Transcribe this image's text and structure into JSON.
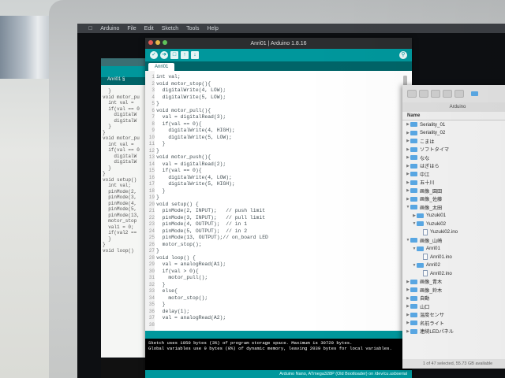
{
  "menubar": {
    "items": [
      "Arduino",
      "File",
      "Edit",
      "Sketch",
      "Tools",
      "Help"
    ]
  },
  "window": {
    "title": "Anri01 | Arduino 1.8.16",
    "tab": "Anri01"
  },
  "back_window": {
    "tab": "Anri01 §",
    "code": [
      "  }",
      "",
      "void motor_pu",
      "  int val =",
      "  if(val == 0",
      "    digitalW",
      "    digitalW",
      "  }",
      "}",
      "",
      "void motor_pu",
      "  int val =",
      "  if(val == 0",
      "    digitalW",
      "    digitalW",
      "  }",
      "}",
      "",
      "void setup()",
      "  int val;",
      "  pinMode(2,",
      "  pinMode(3,",
      "  pinMode(4,",
      "  pinMode(5,",
      "  pinMode(13,",
      "  motor_stop",
      "  val1 = 0;",
      "  if(val2 ==",
      "",
      "  }",
      "}",
      "",
      "void loop()"
    ]
  },
  "editor": {
    "line_numbers": [
      "1",
      "2",
      "3",
      "4",
      "5",
      "6",
      "7",
      "8",
      "9",
      "10",
      "11",
      "12",
      "13",
      "14",
      "15",
      "16",
      "17",
      "18",
      "19",
      "20",
      "21",
      "22",
      "23",
      "24",
      "25",
      "26",
      "27",
      "28",
      "29",
      "30",
      "31",
      "32",
      "33",
      "34",
      "35",
      "36",
      "37",
      "38"
    ],
    "lines": [
      "int val;",
      "",
      "void motor_stop(){",
      "  digitalWrite(4, LOW);",
      "  digitalWrite(5, LOW);",
      "}",
      "",
      "void motor_pull(){",
      "  val = digitalRead(3);",
      "  if(val == 0){",
      "    digitalWrite(4, HIGH);",
      "    digitalWrite(5, LOW);",
      "  }",
      "}",
      "",
      "void motor_push(){",
      "  val = digitalRead(2);",
      "  if(val == 0){",
      "    digitalWrite(4, LOW);",
      "    digitalWrite(5, HIGH);",
      "  }",
      "}",
      "",
      "void setup() {",
      "  pinMode(2, INPUT);   // push limit",
      "  pinMode(3, INPUT);   // pull limit",
      "  pinMode(4, OUTPUT);  // in 1",
      "  pinMode(5, OUTPUT);  // in 2",
      "  pinMode(13, OUTPUT);// on_board LED",
      "  motor_stop();",
      "}",
      "",
      "void loop() {",
      "  val = analogRead(A1);",
      "  if(val > 0){",
      "    motor_pull();",
      "  }",
      "  else{",
      "    motor_stop();",
      "  }",
      "  delay(1);",
      "  val = analogRead(A2);"
    ]
  },
  "console": {
    "lines": [
      "Sketch uses 1050 bytes (3%) of program storage space. Maximum is 30720 bytes.",
      "Global variables use 9 bytes (0%) of dynamic memory, leaving 2039 bytes for local variables."
    ],
    "board": "Arduino Nano, ATmega328P (Old Bootloader) on /dev/cu.usbserial"
  },
  "finder": {
    "title": "Arduino",
    "column_header": "Name",
    "rows": [
      {
        "indent": 0,
        "kind": "folder",
        "expanded": false,
        "name": "Seriality_01"
      },
      {
        "indent": 0,
        "kind": "folder",
        "expanded": false,
        "name": "Seriality_02"
      },
      {
        "indent": 0,
        "kind": "folder",
        "expanded": false,
        "name": "こまは"
      },
      {
        "indent": 0,
        "kind": "folder",
        "expanded": false,
        "name": "ソフトタイマ"
      },
      {
        "indent": 0,
        "kind": "folder",
        "expanded": false,
        "name": "なな"
      },
      {
        "indent": 0,
        "kind": "folder",
        "expanded": false,
        "name": "はぎはら"
      },
      {
        "indent": 0,
        "kind": "folder",
        "expanded": false,
        "name": "中江"
      },
      {
        "indent": 0,
        "kind": "folder",
        "expanded": false,
        "name": "五十川"
      },
      {
        "indent": 0,
        "kind": "folder",
        "expanded": false,
        "name": "画像_園田"
      },
      {
        "indent": 0,
        "kind": "folder",
        "expanded": false,
        "name": "画像_佐藤"
      },
      {
        "indent": 0,
        "kind": "folder",
        "expanded": true,
        "name": "画像_太田"
      },
      {
        "indent": 1,
        "kind": "folder",
        "expanded": false,
        "name": "Yuzuki01"
      },
      {
        "indent": 1,
        "kind": "folder",
        "expanded": true,
        "name": "Yuzuki02"
      },
      {
        "indent": 2,
        "kind": "file",
        "expanded": false,
        "name": "Yuzuki02.ino"
      },
      {
        "indent": 0,
        "kind": "folder",
        "expanded": true,
        "name": "画像_山崎"
      },
      {
        "indent": 1,
        "kind": "folder",
        "expanded": true,
        "name": "Anri01"
      },
      {
        "indent": 2,
        "kind": "file",
        "expanded": false,
        "name": "Anri01.ino"
      },
      {
        "indent": 1,
        "kind": "folder",
        "expanded": true,
        "name": "Anri02"
      },
      {
        "indent": 2,
        "kind": "file",
        "expanded": false,
        "name": "Anri02.ino"
      },
      {
        "indent": 0,
        "kind": "folder",
        "expanded": false,
        "name": "画像_青木"
      },
      {
        "indent": 0,
        "kind": "folder",
        "expanded": false,
        "name": "画像_鈴木"
      },
      {
        "indent": 0,
        "kind": "folder",
        "expanded": false,
        "name": "自動"
      },
      {
        "indent": 0,
        "kind": "folder",
        "expanded": false,
        "name": "山口"
      },
      {
        "indent": 0,
        "kind": "folder",
        "expanded": false,
        "name": "温度センサ"
      },
      {
        "indent": 0,
        "kind": "folder",
        "expanded": false,
        "name": "名前ライト"
      },
      {
        "indent": 0,
        "kind": "folder",
        "expanded": false,
        "name": "連続LEDパネル"
      }
    ],
    "status": "1 of 47 selected, 55.73 GB available"
  },
  "colors": {
    "arduino_teal": "#00979c",
    "arduino_dark": "#006468",
    "folder_blue": "#5aa9e6"
  }
}
